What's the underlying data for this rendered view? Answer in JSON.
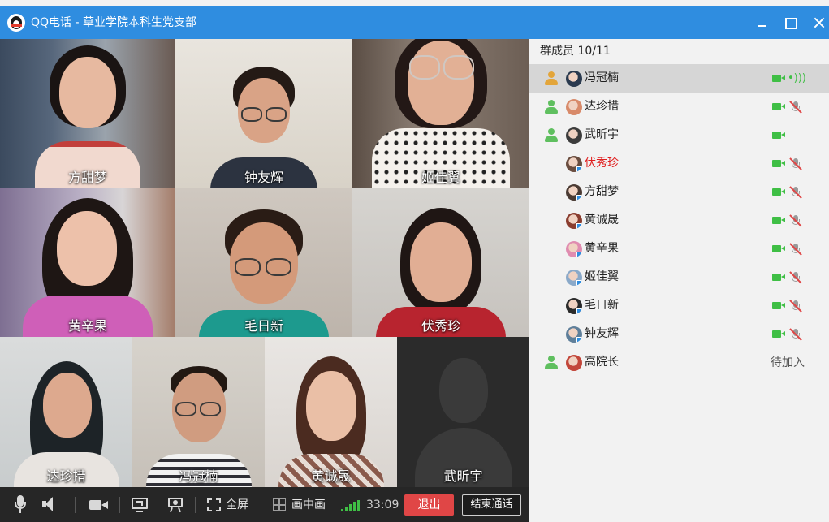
{
  "window": {
    "title": "QQ电话 - 草业学院本科生党支部",
    "controls": [
      "minimize-icon",
      "maximize-icon",
      "close-icon"
    ]
  },
  "video_grid": {
    "tiles": [
      {
        "name": "方甜梦"
      },
      {
        "name": "钟友辉"
      },
      {
        "name": "姬佳翼"
      },
      {
        "name": "黄辛果"
      },
      {
        "name": "毛日新"
      },
      {
        "name": "伏秀珍"
      },
      {
        "name": "达珍措"
      },
      {
        "name": "冯冠楠"
      },
      {
        "name": "黄诚晟"
      },
      {
        "name": "武昕宇"
      }
    ]
  },
  "toolbar": {
    "icons": [
      "microphone-icon",
      "speaker-icon",
      "camera-icon",
      "screen-share-icon",
      "projector-icon"
    ],
    "fullscreen_label": "全屏",
    "pip_label": "画中画",
    "call_time": "33:09",
    "exit_label": "退出",
    "end_call_label": "结束通话"
  },
  "panel": {
    "header": "群成员 10/11",
    "members": [
      {
        "name": "冯冠楠",
        "selected": true,
        "level_icon": true,
        "camera": true,
        "audio": "speaking"
      },
      {
        "name": "达珍措",
        "selected": false,
        "level_icon": true,
        "camera": true,
        "audio": "muted"
      },
      {
        "name": "武昕宇",
        "selected": false,
        "level_icon": true,
        "camera": true,
        "audio": "none"
      },
      {
        "name": "伏秀珍",
        "selected": false,
        "level_icon": false,
        "camera": true,
        "audio": "muted",
        "highlight": true
      },
      {
        "name": "方甜梦",
        "selected": false,
        "level_icon": false,
        "camera": true,
        "audio": "muted"
      },
      {
        "name": "黄诚晟",
        "selected": false,
        "level_icon": false,
        "camera": true,
        "audio": "muted"
      },
      {
        "name": "黄辛果",
        "selected": false,
        "level_icon": false,
        "camera": true,
        "audio": "muted"
      },
      {
        "name": "姬佳翼",
        "selected": false,
        "level_icon": false,
        "camera": true,
        "audio": "muted"
      },
      {
        "name": "毛日新",
        "selected": false,
        "level_icon": false,
        "camera": true,
        "audio": "muted"
      },
      {
        "name": "钟友辉",
        "selected": false,
        "level_icon": false,
        "camera": true,
        "audio": "muted"
      },
      {
        "name": "高院长",
        "selected": false,
        "level_icon": true,
        "camera": false,
        "audio": "none",
        "status": "待加入"
      }
    ]
  },
  "colors": {
    "titlebar": "#2f8de0",
    "exit_button": "#e04646",
    "active_green": "#3fbf45",
    "highlight_red": "#e02020"
  }
}
